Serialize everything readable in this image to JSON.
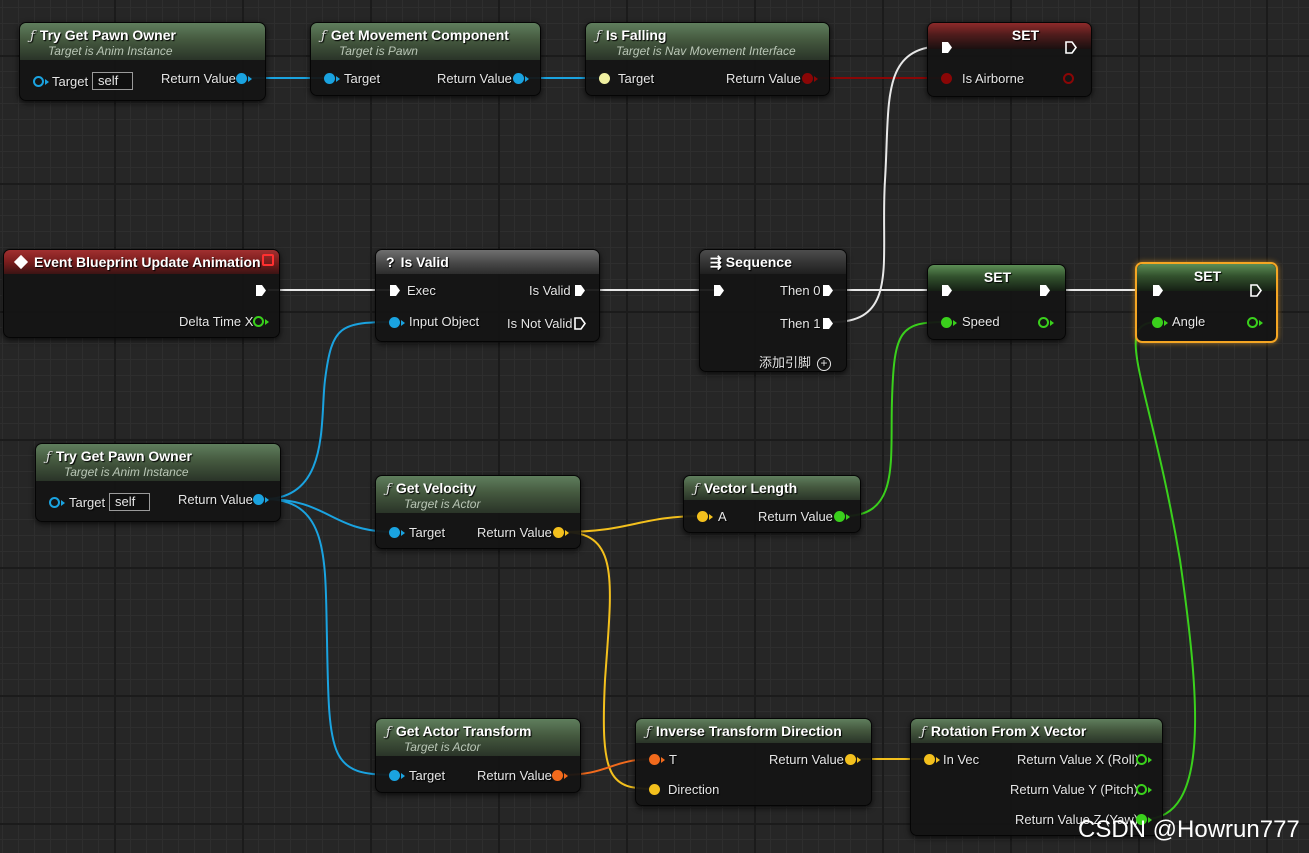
{
  "nodes": {
    "try_get_pawn_owner_top": {
      "title": "Try Get Pawn Owner",
      "subtitle": "Target is Anim Instance",
      "target_label": "Target",
      "target_value": "self",
      "return_label": "Return Value"
    },
    "get_movement_component": {
      "title": "Get Movement Component",
      "subtitle": "Target is Pawn",
      "target_label": "Target",
      "return_label": "Return Value"
    },
    "is_falling": {
      "title": "Is Falling",
      "subtitle": "Target is Nav Movement Interface",
      "target_label": "Target",
      "return_label": "Return Value"
    },
    "set_airborne": {
      "title": "SET",
      "var_label": "Is Airborne"
    },
    "event_update": {
      "title": "Event Blueprint Update Animation",
      "delta_label": "Delta Time X"
    },
    "is_valid": {
      "title": "Is Valid",
      "exec_label": "Exec",
      "input_label": "Input Object",
      "valid_label": "Is Valid",
      "not_valid_label": "Is Not Valid"
    },
    "sequence": {
      "title": "Sequence",
      "then0": "Then 0",
      "then1": "Then 1",
      "add_pin": "添加引脚"
    },
    "set_speed": {
      "title": "SET",
      "var_label": "Speed"
    },
    "set_angle": {
      "title": "SET",
      "var_label": "Angle"
    },
    "try_get_pawn_owner_mid": {
      "title": "Try Get Pawn Owner",
      "subtitle": "Target is Anim Instance",
      "target_label": "Target",
      "target_value": "self",
      "return_label": "Return Value"
    },
    "get_velocity": {
      "title": "Get Velocity",
      "subtitle": "Target is Actor",
      "target_label": "Target",
      "return_label": "Return Value"
    },
    "vector_length": {
      "title": "Vector Length",
      "a_label": "A",
      "return_label": "Return Value"
    },
    "get_actor_transform": {
      "title": "Get Actor Transform",
      "subtitle": "Target is Actor",
      "target_label": "Target",
      "return_label": "Return Value"
    },
    "inverse_transform_direction": {
      "title": "Inverse Transform Direction",
      "t_label": "T",
      "direction_label": "Direction",
      "return_label": "Return Value"
    },
    "rotation_from_x_vector": {
      "title": "Rotation From X Vector",
      "in_label": "In Vec",
      "roll_label": "Return Value X (Roll)",
      "pitch_label": "Return Value Y (Pitch)",
      "yaw_label": "Return Value Z (Yaw)"
    }
  },
  "icons": {
    "function": "ƒ",
    "event": "event-diamond-icon",
    "is_valid": "?",
    "sequence": "sequence-icon"
  },
  "colors": {
    "object_pin": "#1aa3e0",
    "vector_pin": "#f3c01d",
    "transform_pin": "#f26a1c",
    "float_pin": "#3ad01c",
    "bool_pin": "#8a0606",
    "interface_pin": "#f0f0a0",
    "exec_wire": "#e8e8e8",
    "selection": "#f5a623"
  },
  "watermark": "CSDN @Howrun777"
}
